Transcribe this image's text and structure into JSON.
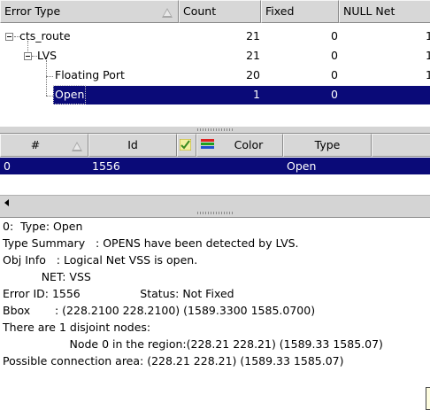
{
  "tree_table": {
    "columns": [
      "Error Type",
      "Count",
      "Fixed",
      "NULL Net"
    ],
    "rows": [
      {
        "label": "cts_route",
        "count": "21",
        "fixed": "0",
        "null_net": "1"
      },
      {
        "label": "LVS",
        "count": "21",
        "fixed": "0",
        "null_net": "1"
      },
      {
        "label": "Floating Port",
        "count": "20",
        "fixed": "0",
        "null_net": "1"
      },
      {
        "label": "Open",
        "count": "1",
        "fixed": "0",
        "null_net": ""
      }
    ],
    "selected_index": 3
  },
  "error_table": {
    "columns": {
      "num": "#",
      "id": "Id",
      "color": "Color",
      "type": "Type"
    },
    "rows": [
      {
        "num": "0",
        "id": "1556",
        "type": "Open"
      }
    ],
    "icons": {
      "check": "checkmark-icon",
      "color": "color-bars-icon"
    },
    "color_bars": [
      "#e02020",
      "#20a020",
      "#2050d0"
    ]
  },
  "details": {
    "lines": [
      "0:  Type: Open",
      "Type Summary   : OPENS have been detected by LVS.",
      "Obj Info   : Logical Net VSS is open.",
      "           NET: VSS",
      "Error ID: 1556                 Status: Not Fixed",
      "Bbox       : (228.2100 228.2100) (1589.3300 1585.0700)",
      "There are 1 disjoint nodes:",
      "                   Node 0 in the region:(228.21 228.21) (1589.33 1585.07)",
      "Possible connection area: (228.21 228.21) (1589.33 1585.07)"
    ]
  }
}
